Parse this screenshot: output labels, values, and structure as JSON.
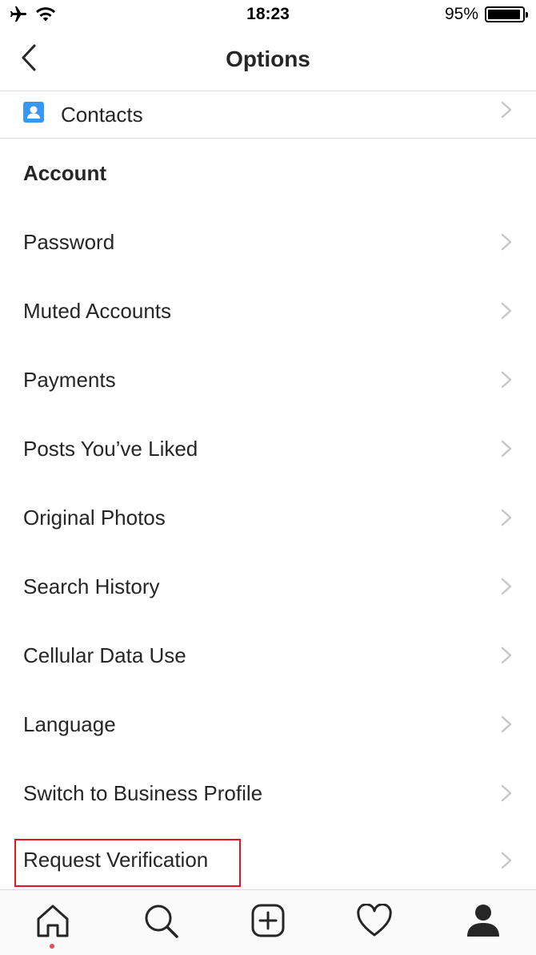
{
  "status_bar": {
    "time": "18:23",
    "battery_text": "95%",
    "battery_level": 0.95,
    "icons": [
      "airplane-icon",
      "wifi-icon",
      "battery-icon"
    ]
  },
  "nav": {
    "title": "Options",
    "back_icon": "chevron-left-icon"
  },
  "contacts_row": {
    "label": "Contacts",
    "icon": "contacts-icon",
    "icon_color": "#3897f0"
  },
  "account_section": {
    "header": "Account",
    "items": [
      {
        "label": "Password"
      },
      {
        "label": "Muted Accounts"
      },
      {
        "label": "Payments"
      },
      {
        "label": "Posts You’ve Liked"
      },
      {
        "label": "Original Photos"
      },
      {
        "label": "Search History"
      },
      {
        "label": "Cellular Data Use"
      },
      {
        "label": "Language"
      },
      {
        "label": "Switch to Business Profile"
      },
      {
        "label": "Request Verification",
        "highlighted": true
      }
    ]
  },
  "tab_bar": {
    "tabs": [
      "home-icon",
      "search-icon",
      "new-post-icon",
      "activity-heart-icon",
      "profile-icon"
    ],
    "active_dot_color": "#ed4956"
  },
  "colors": {
    "text": "#262626",
    "divider": "#dbdbdb",
    "chevron": "#c7c7cc",
    "highlight_border": "#e0171d"
  }
}
